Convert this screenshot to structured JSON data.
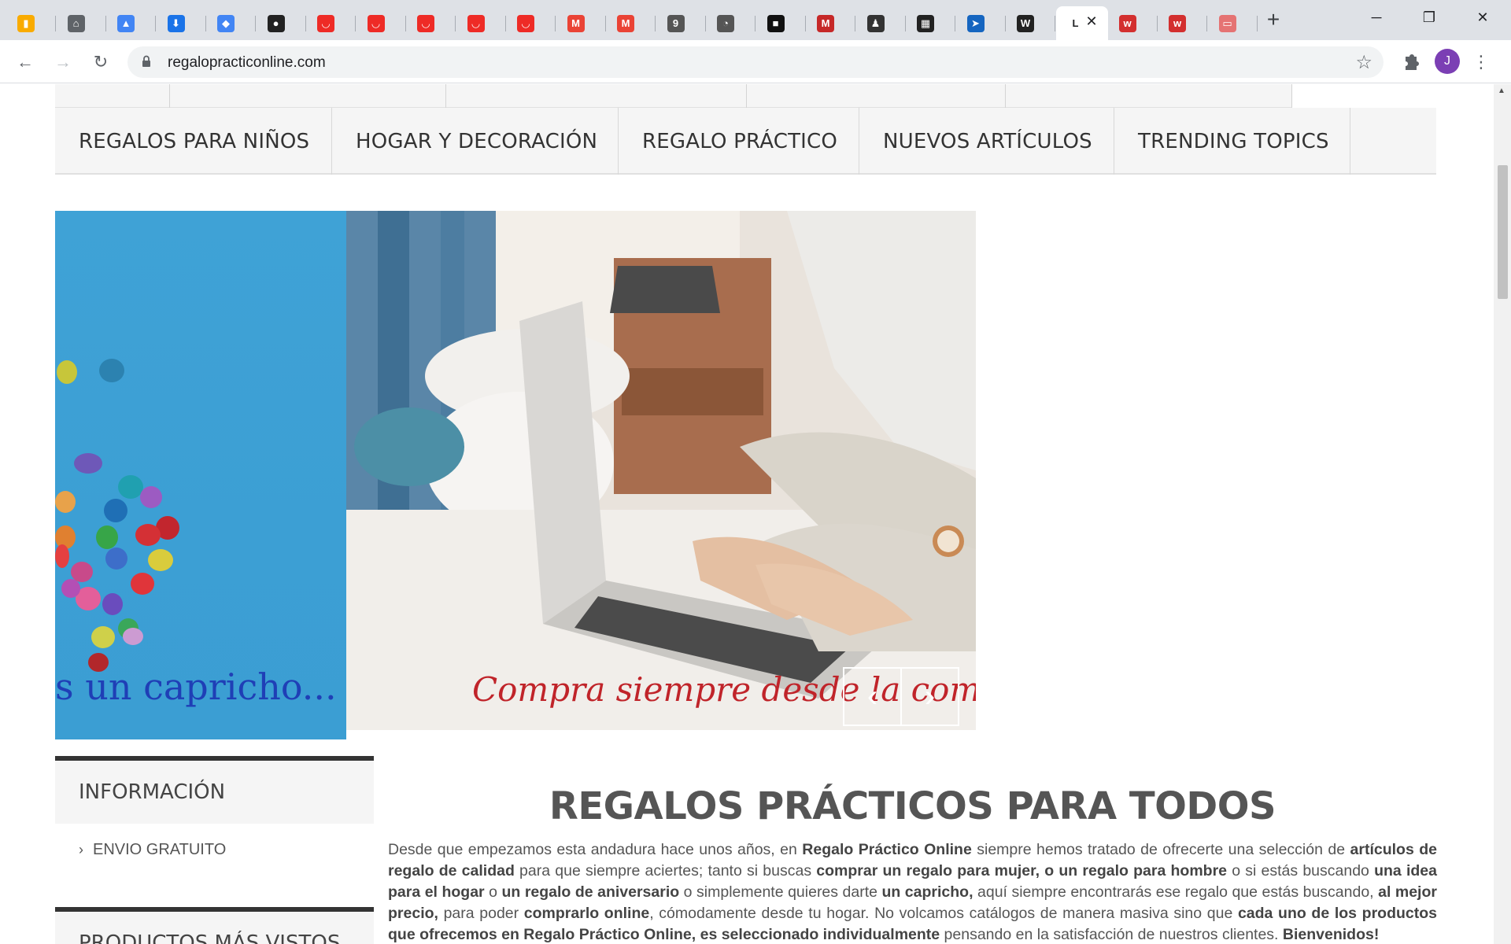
{
  "browser": {
    "tabs": [
      {
        "icon": "analytics-icon",
        "color": "#f9ab00",
        "glyph": "▮"
      },
      {
        "icon": "tab-icon-2",
        "color": "#5f6368",
        "glyph": "⌂"
      },
      {
        "icon": "google-ads-icon",
        "color": "#4285f4",
        "glyph": "▲"
      },
      {
        "icon": "download-icon",
        "color": "#1a73e8",
        "glyph": "⬇"
      },
      {
        "icon": "diamond-icon",
        "color": "#4285f4",
        "glyph": "◆"
      },
      {
        "icon": "hat-icon",
        "color": "#222222",
        "glyph": "●"
      },
      {
        "icon": "shop-icon",
        "color": "#ee2b26",
        "glyph": "◡"
      },
      {
        "icon": "shop-icon",
        "color": "#ee2b26",
        "glyph": "◡"
      },
      {
        "icon": "shop-icon",
        "color": "#ee2b26",
        "glyph": "◡"
      },
      {
        "icon": "shop-icon",
        "color": "#ee2b26",
        "glyph": "◡"
      },
      {
        "icon": "shop-icon",
        "color": "#ee2b26",
        "glyph": "◡"
      },
      {
        "icon": "gmail-icon",
        "color": "#ea4335",
        "glyph": "M"
      },
      {
        "icon": "gmail-icon",
        "color": "#ea4335",
        "glyph": "M"
      },
      {
        "icon": "badge-icon",
        "color": "#555555",
        "glyph": "9"
      },
      {
        "icon": "bird-icon",
        "color": "#555555",
        "glyph": "◔"
      },
      {
        "icon": "unsplash-icon",
        "color": "#111111",
        "glyph": "■"
      },
      {
        "icon": "brand-icon",
        "color": "#c62828",
        "glyph": "M"
      },
      {
        "icon": "figure-icon",
        "color": "#333333",
        "glyph": "♟"
      },
      {
        "icon": "film-icon",
        "color": "#222222",
        "glyph": "▦"
      },
      {
        "icon": "arrow-icon",
        "color": "#1565c0",
        "glyph": "➤"
      },
      {
        "icon": "w-icon",
        "color": "#222222",
        "glyph": "W"
      },
      {
        "icon": "active-tab-icon",
        "color": "#5f6368",
        "glyph": "L"
      },
      {
        "icon": "w-red-icon",
        "color": "#d32f2f",
        "glyph": "w"
      },
      {
        "icon": "w-circle-icon",
        "color": "#d32f2f",
        "glyph": "w"
      },
      {
        "icon": "site-icon",
        "color": "#e57373",
        "glyph": "▭"
      }
    ],
    "active_tab_letter": "L",
    "url": "regalopracticonline.com"
  },
  "nav": {
    "items": [
      "REGALOS PARA NIÑOS",
      "HOGAR Y DECORACIÓN",
      "REGALO PRÁCTICO",
      "NUEVOS ARTÍCULOS",
      "TRENDING TOPICS"
    ]
  },
  "slider": {
    "left_caption": "s un capricho...",
    "right_caption": "Compra siempre desde la comodidad",
    "prev": "‹",
    "next": "›"
  },
  "sidebar": {
    "info_title": "INFORMACIÓN",
    "info_link": "ENVIO GRATUITO",
    "popular_title": "PRODUCTOS MÁS VISTOS"
  },
  "content": {
    "title": "REGALOS PRÁCTICOS PARA TODOS",
    "p1": "Desde que empezamos esta andadura hace unos años, en ",
    "b1": "Regalo Práctico Online",
    "p2": " siempre hemos tratado de ofrecerte una selección de ",
    "b2": "artículos de regalo de calidad",
    "p3": " para que siempre aciertes; tanto si buscas ",
    "b3": "comprar un regalo para mujer,",
    "p4": "  ",
    "b4": "o un regalo para hombre",
    "p5": " o si estás buscando ",
    "b5": "una idea para el hogar",
    "p6": " o ",
    "b6": "un regalo de aniversario",
    "p7": " o simplemente quieres darte ",
    "b7": "un capricho,",
    "p8": " aquí siempre encontrarás ese regalo que estás buscando, ",
    "b8": "al mejor precio,",
    "p9": " para poder ",
    "b9": "comprarlo online",
    "p10": ", cómodamente desde tu hogar. No volcamos catálogos  de manera masiva sino que ",
    "b10": "cada uno de los productos que ofrecemos en Regalo Práctico Online, es seleccionado individualmente",
    "p11": " pensando en la satisfacción de nuestros clientes. ",
    "b11": "Bienvenidos!"
  }
}
